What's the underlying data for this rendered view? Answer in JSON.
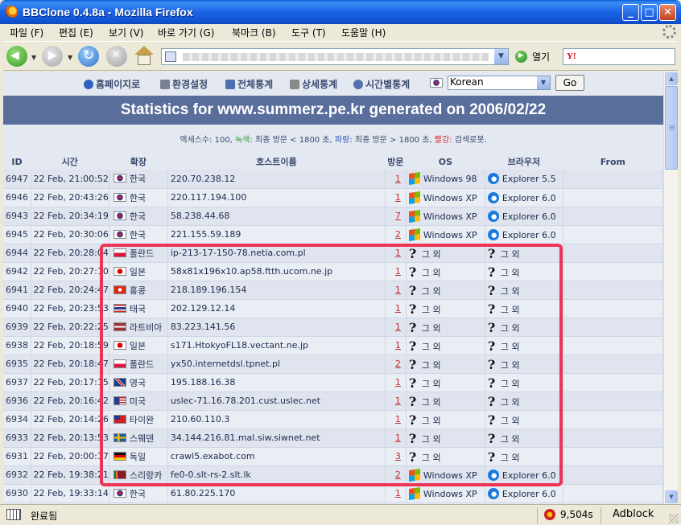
{
  "window": {
    "title": "BBClone 0.4.8a - Mozilla Firefox",
    "min": "_",
    "max": "□",
    "close": "✕"
  },
  "menu": [
    "파일 (F)",
    "편집 (E)",
    "보기 (V)",
    "바로 가기 (G)",
    "북마크 (B)",
    "도구 (T)",
    "도움말 (H)"
  ],
  "toolbar": {
    "go_label": "열기",
    "search_logo": "Y!"
  },
  "links": [
    {
      "label": "홈페이지로",
      "icon": "globe-icon",
      "color": "#3060c0"
    },
    {
      "label": "환경설정",
      "icon": "tools-icon",
      "color": "#7a8090"
    },
    {
      "label": "전체통계",
      "icon": "chart-icon",
      "color": "#4a70b0"
    },
    {
      "label": "상세통계",
      "icon": "document-icon",
      "color": "#8a8a8a"
    },
    {
      "label": "시간별통계",
      "icon": "clock-icon",
      "color": "#5070b0"
    }
  ],
  "language": {
    "selected": "Korean",
    "go": "Go"
  },
  "banner": "Statistics for www.summerz.pe.kr generated on 2006/02/22",
  "legend": {
    "part1": "액세스수: 100, ",
    "green_label": "녹색:",
    "part2": " 최종 방문 < 1800 초, ",
    "blue_label": "파랑:",
    "part3": " 최종 방문 > 1800 초, ",
    "red_label": "빨강:",
    "part4": " 검색로봇."
  },
  "columns": [
    "ID",
    "시간",
    "확장",
    "호스트이름",
    "방문",
    "OS",
    "브라우저",
    "From"
  ],
  "rows": [
    {
      "id": "6947",
      "time": "22 Feb, 21:00:52",
      "flag": "kr",
      "country": "한국",
      "host": "220.70.238.12",
      "visits": "1",
      "os": "Windows 98",
      "os_icon": "windows-icon",
      "browser": "Explorer 5.5",
      "browser_icon": "ie-icon"
    },
    {
      "id": "6946",
      "time": "22 Feb, 20:43:26",
      "flag": "kr",
      "country": "한국",
      "host": "220.117.194.100",
      "visits": "1",
      "os": "Windows XP",
      "os_icon": "windows-icon",
      "browser": "Explorer 6.0",
      "browser_icon": "ie-icon"
    },
    {
      "id": "6943",
      "time": "22 Feb, 20:34:19",
      "flag": "kr",
      "country": "한국",
      "host": "58.238.44.68",
      "visits": "7",
      "os": "Windows XP",
      "os_icon": "windows-icon",
      "browser": "Explorer 6.0",
      "browser_icon": "ie-icon"
    },
    {
      "id": "6945",
      "time": "22 Feb, 20:30:06",
      "flag": "kr",
      "country": "한국",
      "host": "221.155.59.189",
      "visits": "2",
      "os": "Windows XP",
      "os_icon": "windows-icon",
      "browser": "Explorer 6.0",
      "browser_icon": "ie-icon"
    },
    {
      "id": "6944",
      "time": "22 Feb, 20:28:04",
      "flag": "pl",
      "country": "폴란드",
      "host": "ip-213-17-150-78.netia.com.pl",
      "visits": "1",
      "os": "그 외",
      "os_icon": "unknown-icon",
      "browser": "그 외",
      "browser_icon": "unknown-icon"
    },
    {
      "id": "6942",
      "time": "22 Feb, 20:27:10",
      "flag": "jp",
      "country": "일본",
      "host": "58x81x196x10.ap58.ftth.ucom.ne.jp",
      "visits": "1",
      "os": "그 외",
      "os_icon": "unknown-icon",
      "browser": "그 외",
      "browser_icon": "unknown-icon"
    },
    {
      "id": "6941",
      "time": "22 Feb, 20:24:47",
      "flag": "hk",
      "country": "홍콩",
      "host": "218.189.196.154",
      "visits": "1",
      "os": "그 외",
      "os_icon": "unknown-icon",
      "browser": "그 외",
      "browser_icon": "unknown-icon"
    },
    {
      "id": "6940",
      "time": "22 Feb, 20:23:53",
      "flag": "th",
      "country": "태국",
      "host": "202.129.12.14",
      "visits": "1",
      "os": "그 외",
      "os_icon": "unknown-icon",
      "browser": "그 외",
      "browser_icon": "unknown-icon"
    },
    {
      "id": "6939",
      "time": "22 Feb, 20:22:25",
      "flag": "lv",
      "country": "라트비아",
      "host": "83.223.141.56",
      "visits": "1",
      "os": "그 외",
      "os_icon": "unknown-icon",
      "browser": "그 외",
      "browser_icon": "unknown-icon"
    },
    {
      "id": "6938",
      "time": "22 Feb, 20:18:59",
      "flag": "jp",
      "country": "일본",
      "host": "s171.HtokyoFL18.vectant.ne.jp",
      "visits": "1",
      "os": "그 외",
      "os_icon": "unknown-icon",
      "browser": "그 외",
      "browser_icon": "unknown-icon"
    },
    {
      "id": "6935",
      "time": "22 Feb, 20:18:47",
      "flag": "pl",
      "country": "폴란드",
      "host": "yx50.internetdsl.tpnet.pl",
      "visits": "2",
      "os": "그 외",
      "os_icon": "unknown-icon",
      "browser": "그 외",
      "browser_icon": "unknown-icon"
    },
    {
      "id": "6937",
      "time": "22 Feb, 20:17:15",
      "flag": "uk",
      "country": "영국",
      "host": "195.188.16.38",
      "visits": "1",
      "os": "그 외",
      "os_icon": "unknown-icon",
      "browser": "그 외",
      "browser_icon": "unknown-icon"
    },
    {
      "id": "6936",
      "time": "22 Feb, 20:16:42",
      "flag": "us",
      "country": "미국",
      "host": "uslec-71.16.78.201.cust.uslec.net",
      "visits": "1",
      "os": "그 외",
      "os_icon": "unknown-icon",
      "browser": "그 외",
      "browser_icon": "unknown-icon"
    },
    {
      "id": "6934",
      "time": "22 Feb, 20:14:26",
      "flag": "tw",
      "country": "타이완",
      "host": "210.60.110.3",
      "visits": "1",
      "os": "그 외",
      "os_icon": "unknown-icon",
      "browser": "그 외",
      "browser_icon": "unknown-icon"
    },
    {
      "id": "6933",
      "time": "22 Feb, 20:13:53",
      "flag": "se",
      "country": "스웨덴",
      "host": "34.144.216.81.mal.siw.siwnet.net",
      "visits": "1",
      "os": "그 외",
      "os_icon": "unknown-icon",
      "browser": "그 외",
      "browser_icon": "unknown-icon"
    },
    {
      "id": "6931",
      "time": "22 Feb, 20:00:17",
      "flag": "de",
      "country": "독일",
      "host": "crawl5.exabot.com",
      "visits": "3",
      "os": "그 외",
      "os_icon": "unknown-icon",
      "browser": "그 외",
      "browser_icon": "unknown-icon"
    },
    {
      "id": "6932",
      "time": "22 Feb, 19:38:21",
      "flag": "lk",
      "country": "스리랑카",
      "host": "fe0-0.slt-rs-2.slt.lk",
      "visits": "2",
      "os": "Windows XP",
      "os_icon": "windows-icon",
      "browser": "Explorer 6.0",
      "browser_icon": "ie-icon"
    },
    {
      "id": "6930",
      "time": "22 Feb, 19:33:14",
      "flag": "kr",
      "country": "한국",
      "host": "61.80.225.170",
      "visits": "1",
      "os": "Windows XP",
      "os_icon": "windows-icon",
      "browser": "Explorer 6.0",
      "browser_icon": "ie-icon"
    }
  ],
  "status": {
    "text": "완료됨",
    "count": "9,504s",
    "adblock": "Adblock"
  },
  "colors": {
    "banner": "#5a6e9c",
    "highlight": "#ee3355",
    "title_bar": "#1b64e6"
  }
}
